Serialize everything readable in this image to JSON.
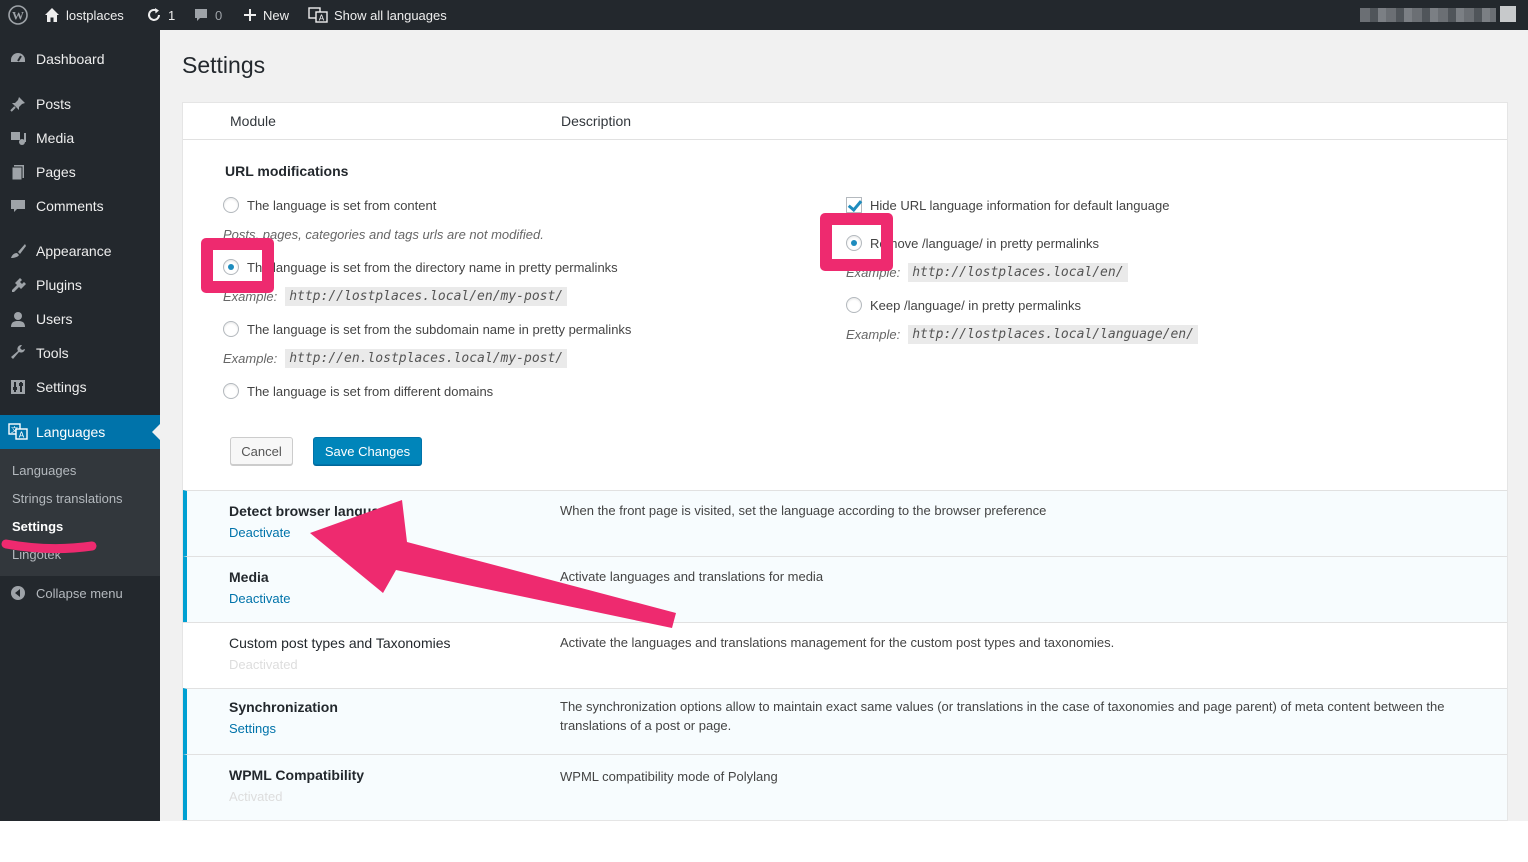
{
  "adminbar": {
    "site_name": "lostplaces",
    "updates_count": "1",
    "comments_count": "0",
    "new_label": "New",
    "languages_label": "Show all languages"
  },
  "sidebar": {
    "items": [
      {
        "label": "Dashboard",
        "icon": "dashboard-icon"
      },
      {
        "label": "Posts",
        "icon": "pushpin-icon"
      },
      {
        "label": "Media",
        "icon": "media-icon"
      },
      {
        "label": "Pages",
        "icon": "pages-icon"
      },
      {
        "label": "Comments",
        "icon": "comment-icon"
      },
      {
        "label": "Appearance",
        "icon": "paintbrush-icon"
      },
      {
        "label": "Plugins",
        "icon": "plug-icon"
      },
      {
        "label": "Users",
        "icon": "user-icon"
      },
      {
        "label": "Tools",
        "icon": "wrench-icon"
      },
      {
        "label": "Settings",
        "icon": "settings-sliders-icon"
      },
      {
        "label": "Languages",
        "icon": "translation-icon"
      }
    ],
    "submenu": [
      "Languages",
      "Strings translations",
      "Settings",
      "Lingotek"
    ],
    "collapse_label": "Collapse menu"
  },
  "page": {
    "title": "Settings"
  },
  "table": {
    "col_module": "Module",
    "col_description": "Description"
  },
  "url_mods": {
    "title": "URL modifications",
    "opt_content": "The language is set from content",
    "hint_content": "Posts, pages, categories and tags urls are not modified.",
    "opt_directory": "The language is set from the directory name in pretty permalinks",
    "example_label": "Example:",
    "example_directory": "http://lostplaces.local/en/my-post/",
    "opt_subdomain": "The language is set from the subdomain name in pretty permalinks",
    "example_subdomain": "http://en.lostplaces.local/my-post/",
    "opt_domains": "The language is set from different domains",
    "hide_default": "Hide URL language information for default language",
    "opt_remove": "Remove /language/ in pretty permalinks",
    "example_remove": "http://lostplaces.local/en/",
    "opt_keep": "Keep /language/ in pretty permalinks",
    "example_keep": "http://lostplaces.local/language/en/",
    "cancel": "Cancel",
    "save": "Save Changes"
  },
  "modules": [
    {
      "name": "Detect browser language",
      "link": "Deactivate",
      "desc": "When the front page is visited, set the language according to the browser preference"
    },
    {
      "name": "Media",
      "link": "Deactivate",
      "desc": "Activate languages and translations for media"
    },
    {
      "name": "Custom post types and Taxonomies",
      "link": "Deactivated",
      "desc": "Activate the languages and translations management for the custom post types and taxonomies."
    },
    {
      "name": "Synchronization",
      "link": "Settings",
      "desc": "The synchronization options allow to maintain exact same values (or translations in the case of taxonomies and page parent) of meta content between the translations of a post or page."
    },
    {
      "name": "WPML Compatibility",
      "link": "Activated",
      "desc": "WPML compatibility mode of Polylang"
    }
  ],
  "colors": {
    "adminbar": "#23282d",
    "accent": "#0073aa",
    "highlight": "#ee2a6f",
    "active_border": "#00a0d2"
  }
}
